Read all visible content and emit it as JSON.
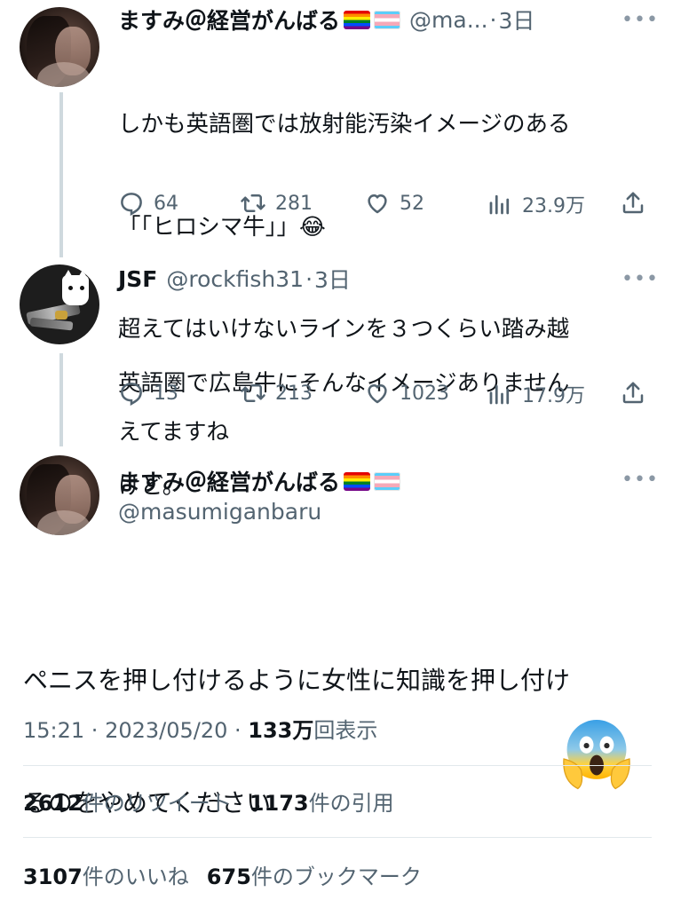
{
  "reply1": {
    "name": "ますみ＠経営がんばる",
    "flags": [
      "rainbow-flag-emoji",
      "transgender-flag-emoji"
    ],
    "handle": "@ma...",
    "sep": "·",
    "time": "3日",
    "text_lines": [
      "しかも英語圏では放射能汚染イメージのある",
      "「「ヒロシマ牛」」😂",
      "超えてはいけないラインを３つくらい踏み越",
      "えてますね"
    ],
    "more": "•••",
    "stats": {
      "replies": "64",
      "retweets": "281",
      "likes": "52",
      "views": "23.9万"
    }
  },
  "reply2": {
    "name": "JSF",
    "handle": "@rockfish31",
    "sep": "·",
    "time": "3日",
    "text_lines": [
      "英語圏で広島牛にそんなイメージありません",
      "けど。"
    ],
    "more": "•••",
    "stats": {
      "replies": "13",
      "retweets": "213",
      "likes": "1023",
      "views": "17.9万"
    }
  },
  "main": {
    "name": "ますみ＠経営がんばる",
    "handle": "@masumiganbaru",
    "more": "•••",
    "text_lines": [
      "ペニスを押し付けるように女性に知識を押し付け",
      "るのをやめてください"
    ],
    "time": "15:21",
    "sep1": " · ",
    "date": "2023/05/20",
    "sep2": " · ",
    "views_num": "133万",
    "views_label": "回表示",
    "retweets_num": "2612",
    "retweets_label": "件のリツイート",
    "quotes_num": "1173",
    "quotes_label": "件の引用",
    "likes_num": "3107",
    "likes_label": "件のいいね",
    "bookmarks_num": "675",
    "bookmarks_label": "件のブックマーク"
  },
  "overlay_emoji": "face-screaming-in-fear-emoji",
  "colors": {
    "text": "#0f1419",
    "muted": "#536471",
    "line": "#cfd9de",
    "divider": "#e2e8ec"
  }
}
